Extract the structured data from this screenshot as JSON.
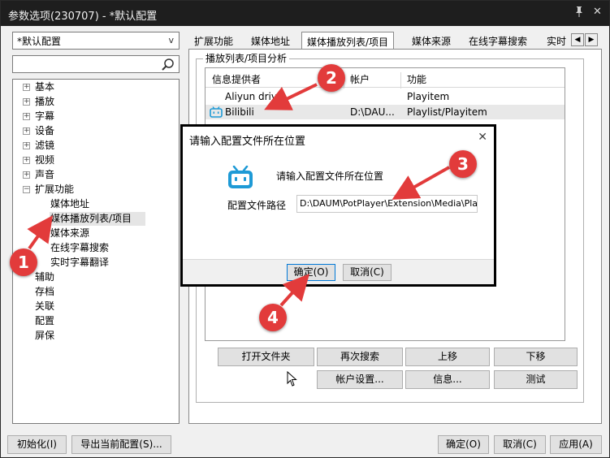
{
  "window": {
    "title": "参数选项(230707) - *默认配置",
    "pin_icon": "pin-icon",
    "close_glyph": "✕"
  },
  "left": {
    "profile_combo": "*默认配置",
    "combo_arrow": "v",
    "search_placeholder": "",
    "tree": [
      {
        "label": "基本",
        "expander": "+"
      },
      {
        "label": "播放",
        "expander": "+"
      },
      {
        "label": "字幕",
        "expander": "+"
      },
      {
        "label": "设备",
        "expander": "+"
      },
      {
        "label": "滤镜",
        "expander": "+"
      },
      {
        "label": "视频",
        "expander": "+"
      },
      {
        "label": "声音",
        "expander": "+"
      },
      {
        "label": "扩展功能",
        "expander": "−"
      },
      {
        "label": "媒体地址",
        "expander": ""
      },
      {
        "label": "媒体播放列表/项目",
        "expander": "",
        "selected": true
      },
      {
        "label": "媒体来源",
        "expander": ""
      },
      {
        "label": "在线字幕搜索",
        "expander": ""
      },
      {
        "label": "实时字幕翻译",
        "expander": ""
      },
      {
        "label": "辅助",
        "expander": ""
      },
      {
        "label": "存档",
        "expander": ""
      },
      {
        "label": "关联",
        "expander": ""
      },
      {
        "label": "配置",
        "expander": ""
      },
      {
        "label": "屏保",
        "expander": ""
      }
    ]
  },
  "tabs": [
    "扩展功能",
    "媒体地址",
    "媒体播放列表/项目",
    "媒体来源",
    "在线字幕搜索",
    "实时"
  ],
  "tab_scroll": {
    "left": "◀",
    "right": "▶"
  },
  "group_title": "播放列表/项目分析",
  "list": {
    "columns": [
      "信息提供者",
      "帐户",
      "功能"
    ],
    "rows": [
      {
        "provider": "Aliyun drive",
        "account": "",
        "function": "Playitem"
      },
      {
        "provider": "Bilibili",
        "account": "D:\\DAU...",
        "function": "Playlist/Playitem"
      },
      {
        "provider": "",
        "account": "",
        "function": ""
      }
    ]
  },
  "buttons": {
    "open_folder": "打开文件夹",
    "search_again": "再次搜索",
    "move_up": "上移",
    "move_down": "下移",
    "account_settings": "帐户设置...",
    "info": "信息...",
    "test": "测试"
  },
  "dialog": {
    "title": "请输入配置文件所在位置",
    "close": "✕",
    "prompt": "请输入配置文件所在位置",
    "path_label": "配置文件路径",
    "path_value": "D:\\DAUM\\PotPlayer\\Extension\\Media\\PlayParse\\",
    "ok": "确定(O)",
    "cancel": "取消(C)"
  },
  "bottom": {
    "initialize": "初始化(I)",
    "export": "导出当前配置(S)...",
    "ok": "确定(O)",
    "cancel": "取消(C)",
    "apply": "应用(A)"
  },
  "annotations": [
    "1",
    "2",
    "3",
    "4"
  ],
  "colors": {
    "badge": "#e23b3b",
    "bilibili_blue": "#1e9ad6",
    "titlebar": "#1e1e1e"
  }
}
